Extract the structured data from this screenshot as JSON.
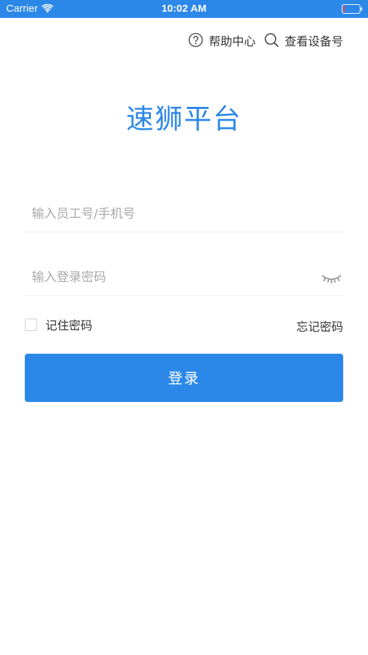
{
  "status_bar": {
    "carrier": "Carrier",
    "time": "10:02 AM",
    "battery_level": 0.1,
    "background_color": "#2c88e8"
  },
  "top_links": {
    "help": {
      "label": "帮助中心",
      "icon": "question-circle-icon"
    },
    "device": {
      "label": "查看设备号",
      "icon": "search-icon"
    }
  },
  "brand": {
    "title": "速狮平台",
    "color": "#2c88e8"
  },
  "form": {
    "account_placeholder": "输入员工号/手机号",
    "account_value": "",
    "password_placeholder": "输入登录密码",
    "password_value": "",
    "password_toggle_icon": "eye-closed-icon",
    "remember_label": "记住密码",
    "remember_checked": false,
    "forgot_label": "忘记密码",
    "login_label": "登录"
  },
  "colors": {
    "accent": "#2c88e8",
    "placeholder": "#a9a9a9",
    "text": "#333333"
  }
}
